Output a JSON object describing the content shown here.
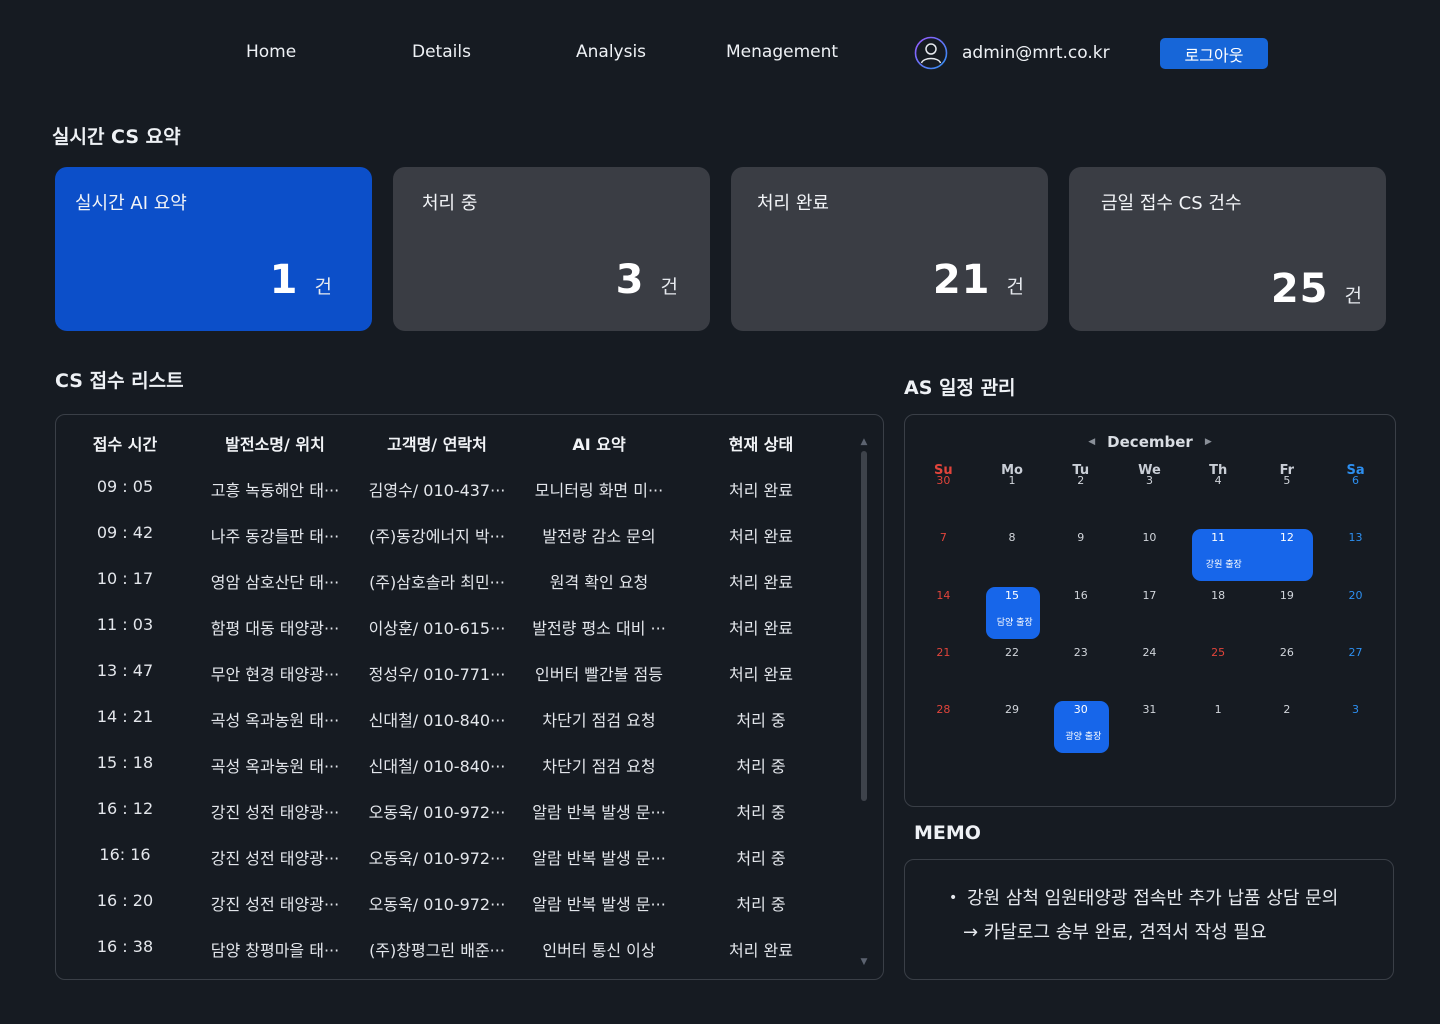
{
  "nav": {
    "items": [
      "Home",
      "Details",
      "Analysis",
      "Menagement"
    ],
    "user_email": "admin@mrt.co.kr",
    "logout_label": "로그아웃"
  },
  "summary": {
    "title": "실시간 CS 요약",
    "cards": [
      {
        "title": "실시간 AI 요약",
        "count": "1",
        "unit": "건"
      },
      {
        "title": "처리 중",
        "count": "3",
        "unit": "건"
      },
      {
        "title": "처리 완료",
        "count": "21",
        "unit": "건"
      },
      {
        "title": "금일 접수 CS 건수",
        "count": "25",
        "unit": "건"
      }
    ]
  },
  "cs_list": {
    "title": "CS 접수 리스트",
    "columns": [
      "접수 시간",
      "발전소명/ 위치",
      "고객명/ 연락처",
      "AI 요약",
      "현재 상태"
    ],
    "rows": [
      [
        "09 : 05",
        "고흥 녹동해안 태···",
        "김영수/ 010-437···",
        "모니터링 화면 미···",
        "처리 완료"
      ],
      [
        "09 : 42",
        "나주 동강들판 태···",
        "(주)동강에너지 박···",
        "발전량 감소 문의",
        "처리 완료"
      ],
      [
        "10 : 17",
        "영암 삼호산단 태···",
        "(주)삼호솔라 최민···",
        "원격 확인 요청",
        "처리 완료"
      ],
      [
        "11 : 03",
        "함평 대동 태양광···",
        "이상훈/ 010-615···",
        "발전량 평소 대비 ···",
        "처리 완료"
      ],
      [
        "13 : 47",
        "무안 현경 태양광···",
        "정성우/ 010-771···",
        "인버터 빨간불 점등",
        "처리 완료"
      ],
      [
        "14 : 21",
        "곡성 옥과농원 태···",
        "신대철/ 010-840···",
        "차단기 점검 요청",
        "처리 중"
      ],
      [
        "15 : 18",
        "곡성 옥과농원 태···",
        "신대철/ 010-840···",
        "차단기 점검 요청",
        "처리 중"
      ],
      [
        "16 : 12",
        "강진 성전 태양광···",
        "오동욱/ 010-972···",
        "알람 반복 발생 문···",
        "처리 중"
      ],
      [
        "16: 16",
        "강진 성전 태양광···",
        "오동욱/ 010-972···",
        "알람 반복 발생 문···",
        "처리 중"
      ],
      [
        "16 : 20",
        "강진 성전 태양광···",
        "오동욱/ 010-972···",
        "알람 반복 발생 문···",
        "처리 중"
      ],
      [
        "16 : 38",
        "담양 창평마을 태···",
        "(주)창평그린 배준···",
        "인버터 통신 이상",
        "처리 완료"
      ]
    ]
  },
  "calendar": {
    "title": "AS 일정 관리",
    "month": "December",
    "weekdays": [
      "Su",
      "Mo",
      "Tu",
      "We",
      "Th",
      "Fr",
      "Sa"
    ],
    "weeks": [
      [
        "30",
        "1",
        "2",
        "3",
        "4",
        "5",
        "6"
      ],
      [
        "7",
        "8",
        "9",
        "10",
        "11",
        "12",
        "13"
      ],
      [
        "14",
        "15",
        "16",
        "17",
        "18",
        "19",
        "20"
      ],
      [
        "21",
        "22",
        "23",
        "24",
        "25",
        "26",
        "27"
      ],
      [
        "28",
        "29",
        "30",
        "31",
        "1",
        "2",
        "3"
      ]
    ],
    "holiday": "25",
    "events": [
      {
        "label": "강원 출장"
      },
      {
        "label": "담양 출장"
      },
      {
        "label": "광양 출장"
      }
    ],
    "colors": {
      "sunday": "#e0443b",
      "saturday": "#2d8ff0",
      "event": "#1766ea"
    }
  },
  "memo": {
    "title": "MEMO",
    "lines": [
      "강원 삼척 임원태양광 접속반 추가 납품 상담 문의",
      "→ 카달로그 송부 완료, 견적서 작성 필요"
    ]
  },
  "colors": {
    "background": "#161b22",
    "card": "#3a3d44",
    "accent": "#0c4fc9",
    "button": "#1766d8"
  }
}
